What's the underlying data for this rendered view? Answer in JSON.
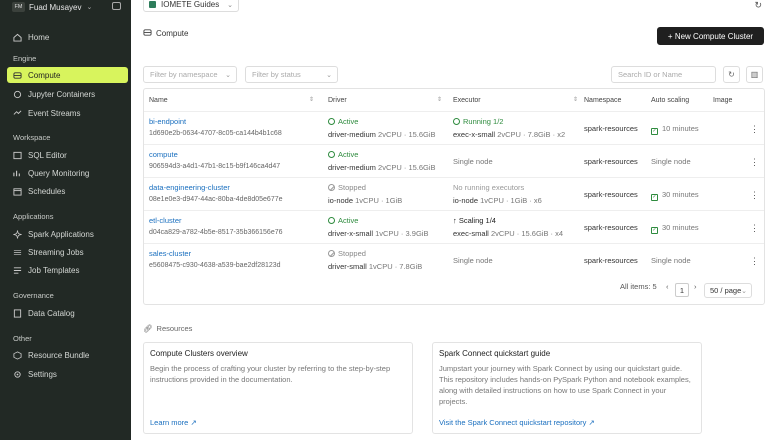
{
  "sidebar": {
    "avatar": "FM",
    "user": "Fuad Musayev",
    "sections": {
      "engine": "Engine",
      "workspace": "Workspace",
      "applications": "Applications",
      "governance": "Governance",
      "other": "Other"
    },
    "items": {
      "home": "Home",
      "compute": "Compute",
      "jupyter": "Jupyter Containers",
      "event_streams": "Event Streams",
      "sql_editor": "SQL Editor",
      "query_monitoring": "Query Monitoring",
      "schedules": "Schedules",
      "spark_apps": "Spark Applications",
      "streaming_jobs": "Streaming Jobs",
      "job_templates": "Job Templates",
      "data_catalog": "Data Catalog",
      "resource_bundle": "Resource Bundle",
      "settings": "Settings"
    }
  },
  "header": {
    "project": "IOMETE Guides",
    "page_title": "Compute",
    "new_button": "+ New Compute Cluster"
  },
  "filters": {
    "namespace": "Filter by namespace",
    "status": "Filter by status",
    "search": "Search ID or Name"
  },
  "table": {
    "headers": {
      "name": "Name",
      "driver": "Driver",
      "executor": "Executor",
      "namespace": "Namespace",
      "autoscaling": "Auto scaling",
      "image": "Image"
    },
    "rows": [
      {
        "name": "bi-endpoint",
        "id": "1d690e2b-0634-4707-8c05-ca144b4b1c68",
        "driver_status": "Active",
        "driver": "driver-medium",
        "driver_spec": "2vCPU · 15.6GiB",
        "exec_status": "Running 1/2",
        "executor": "exec-x-small",
        "exec_spec": "2vCPU · 7.8GiB · x2",
        "namespace": "spark-resources",
        "autoscaling": "10 minutes"
      },
      {
        "name": "compute",
        "id": "906594d3-a4d1-47b1-8c15-b9f146ca4d47",
        "driver_status": "Active",
        "driver": "driver-medium",
        "driver_spec": "2vCPU · 15.6GiB",
        "exec_status": "",
        "executor": "Single node",
        "exec_spec": "",
        "namespace": "spark-resources",
        "autoscaling": "Single node"
      },
      {
        "name": "data-engineering-cluster",
        "id": "08e1e0e3-d947-44ac-80ba-4de8d05e677e",
        "driver_status": "Stopped",
        "driver": "io-node",
        "driver_spec": "1vCPU · 1GiB",
        "exec_status": "No running executors",
        "executor": "io-node",
        "exec_spec": "1vCPU · 1GiB · x6",
        "namespace": "spark-resources",
        "autoscaling": "30 minutes"
      },
      {
        "name": "etl-cluster",
        "id": "d04ca829-a782-4b5e-8517-35b366156e76",
        "driver_status": "Active",
        "driver": "driver-x-small",
        "driver_spec": "1vCPU · 3.9GiB",
        "exec_status": "Scaling 1/4",
        "executor": "exec-small",
        "exec_spec": "2vCPU · 15.6GiB · x4",
        "namespace": "spark-resources",
        "autoscaling": "30 minutes"
      },
      {
        "name": "sales-cluster",
        "id": "e5608475-c930-4638-a539-bae2df28123d",
        "driver_status": "Stopped",
        "driver": "driver-small",
        "driver_spec": "1vCPU · 7.8GiB",
        "exec_status": "",
        "executor": "Single node",
        "exec_spec": "",
        "namespace": "spark-resources",
        "autoscaling": "Single node"
      }
    ]
  },
  "pagination": {
    "total": "All items: 5",
    "prev": "‹",
    "page": "1",
    "next": "›",
    "page_size": "50 / page"
  },
  "resources": {
    "title": "Resources",
    "cards": [
      {
        "title": "Compute Clusters overview",
        "desc": "Begin the process of crafting your cluster by referring to the step-by-step instructions provided in the documentation.",
        "link": "Learn more"
      },
      {
        "title": "Spark Connect quickstart guide",
        "desc": "Jumpstart your journey with Spark Connect by using our quickstart guide. This repository includes hands-on PySpark Python and notebook examples, along with detailed instructions on how to use Spark Connect in your projects.",
        "link": "Visit the Spark Connect quickstart repository"
      }
    ]
  }
}
